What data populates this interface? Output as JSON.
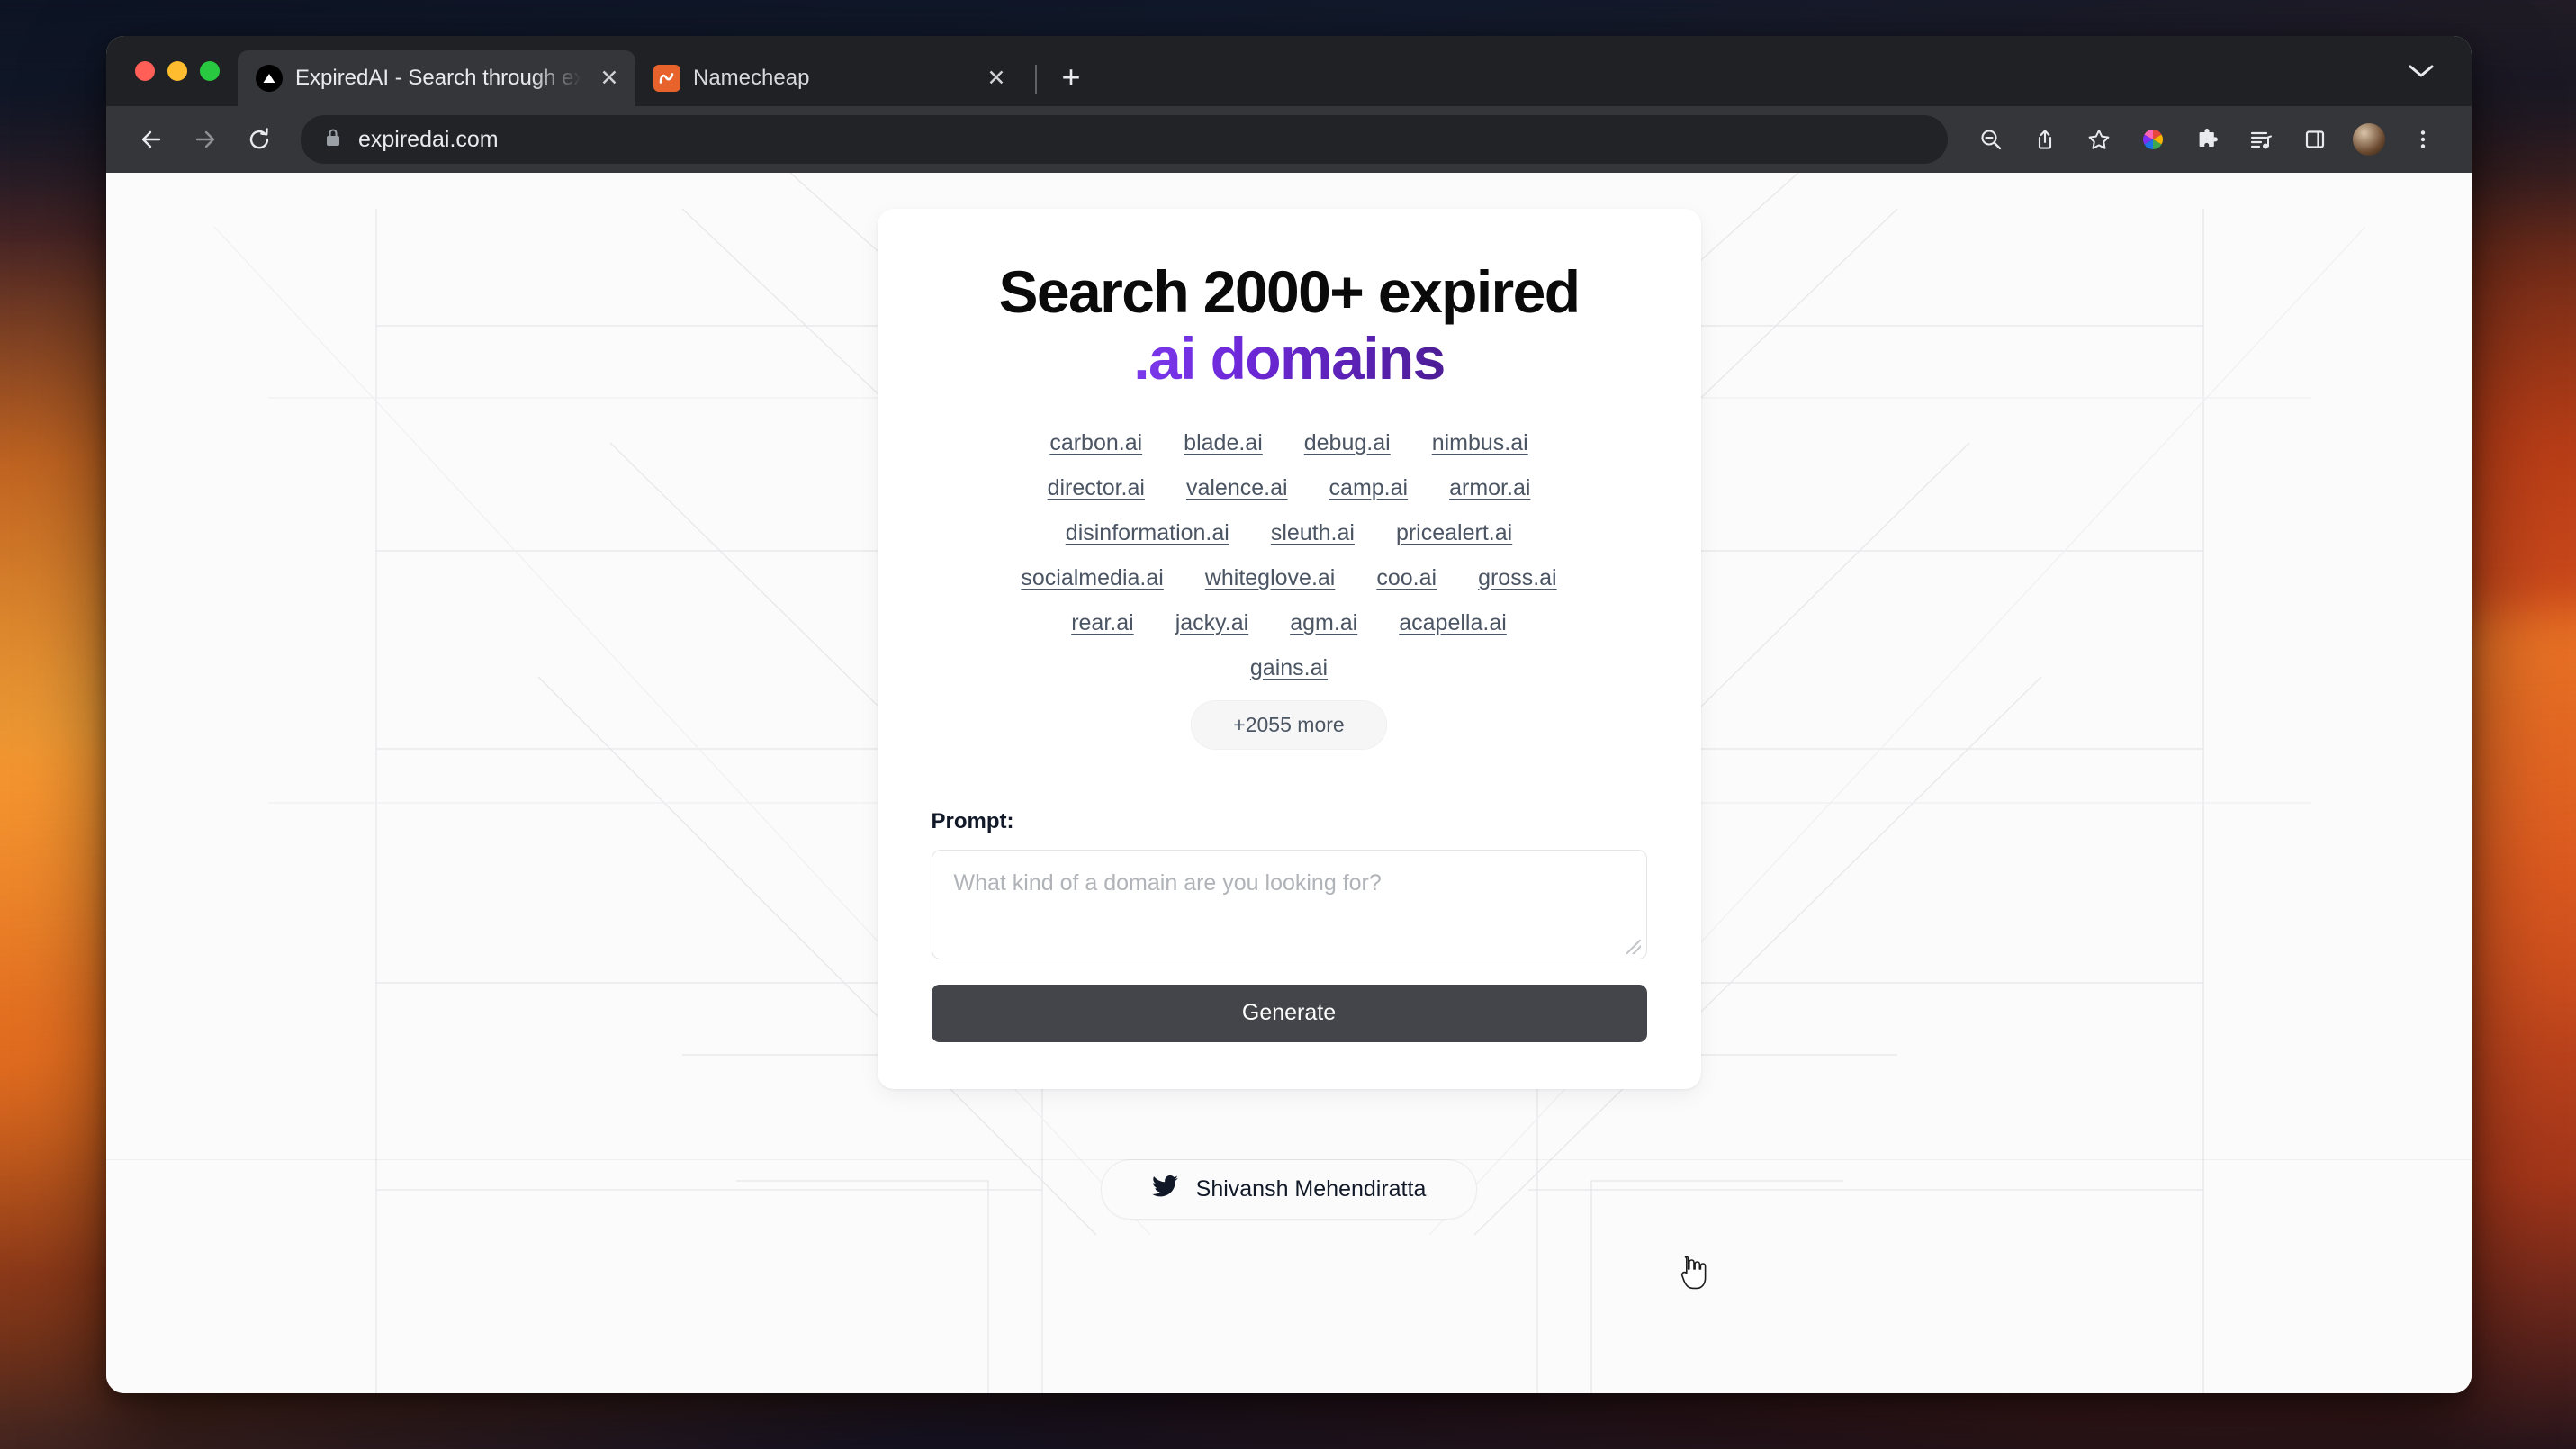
{
  "browser": {
    "traffic_lights": [
      "close",
      "minimize",
      "maximize"
    ],
    "tabs": [
      {
        "title": "ExpiredAI - Search through exp",
        "favicon": "vercel-triangle-icon",
        "active": true,
        "close_label": "✕"
      },
      {
        "title": "Namecheap",
        "favicon": "namecheap-icon",
        "active": false,
        "close_label": "✕"
      }
    ],
    "new_tab_label": "+",
    "tabstrip_chevron": "chevron-down-icon",
    "toolbar": {
      "back": "back-arrow-icon",
      "forward": "forward-arrow-icon",
      "reload": "reload-icon",
      "lock": "lock-icon",
      "url": "expiredai.com",
      "right_icons": [
        "zoom-out-icon",
        "share-icon",
        "bookmark-star-icon",
        "color-wheel-icon",
        "extensions-puzzle-icon",
        "reading-list-icon",
        "side-panel-icon",
        "profile-avatar",
        "three-dot-menu-icon"
      ]
    }
  },
  "page": {
    "headline": {
      "line1": "Search 2000+ expired",
      "line2": ".ai domains",
      "accent_color": "#6d28d9"
    },
    "domain_rows": [
      [
        "carbon.ai",
        "blade.ai",
        "debug.ai",
        "nimbus.ai"
      ],
      [
        "director.ai",
        "valence.ai",
        "camp.ai",
        "armor.ai"
      ],
      [
        "disinformation.ai",
        "sleuth.ai",
        "pricealert.ai"
      ],
      [
        "socialmedia.ai",
        "whiteglove.ai",
        "coo.ai",
        "gross.ai"
      ],
      [
        "rear.ai",
        "jacky.ai",
        "agm.ai",
        "acapella.ai"
      ],
      [
        "gains.ai"
      ]
    ],
    "more_badge": "+2055 more",
    "prompt": {
      "label": "Prompt:",
      "placeholder": "What kind of a domain are you looking for?",
      "value": ""
    },
    "generate_button": "Generate",
    "footer": {
      "twitter_icon": "twitter-bird-icon",
      "author": "Shivansh Mehendiratta"
    }
  }
}
